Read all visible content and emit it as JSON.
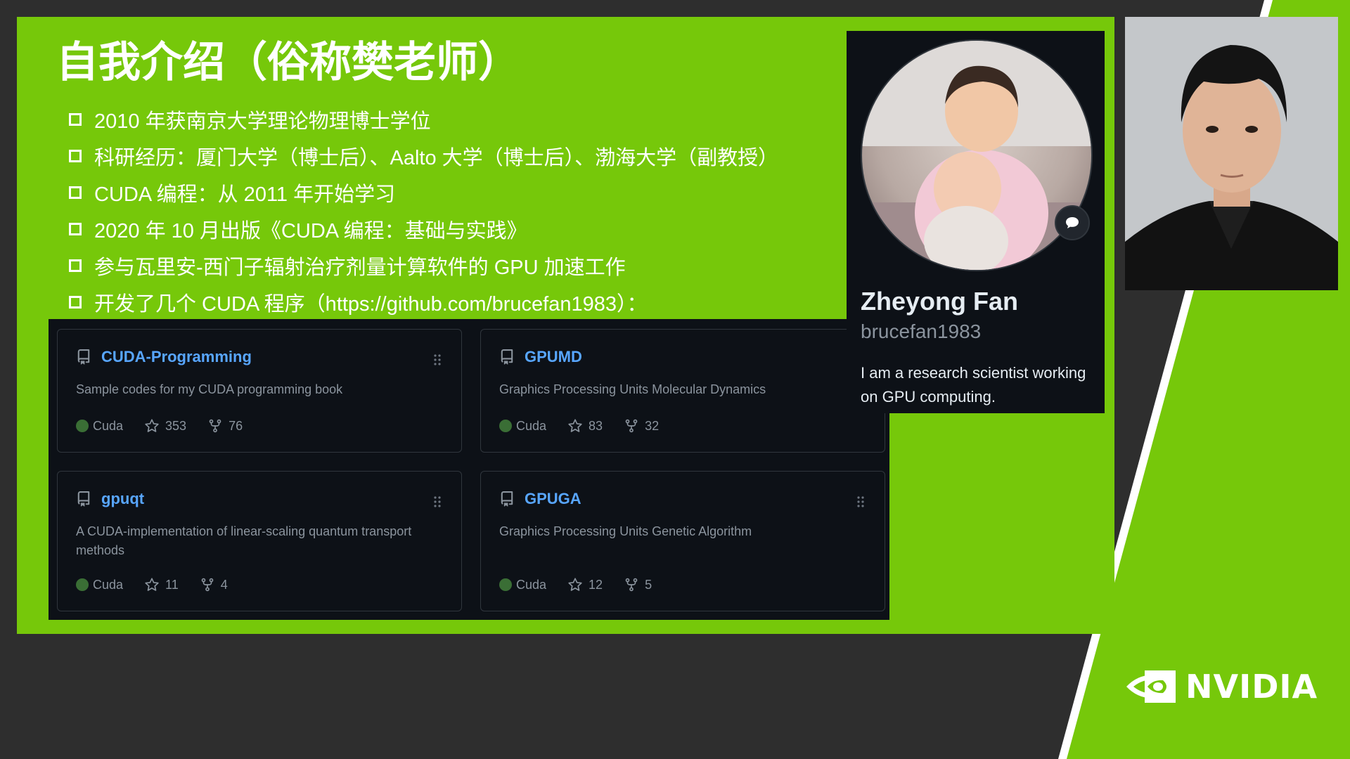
{
  "slide": {
    "title": "自我介绍（俗称樊老师）",
    "bullets": [
      "2010 年获南京大学理论物理博士学位",
      "科研经历：厦门大学（博士后）、Aalto 大学（博士后）、渤海大学（副教授）",
      "CUDA 编程：从 2011 年开始学习",
      "2020 年 10 月出版《CUDA 编程：基础与实践》",
      "参与瓦里安-西门子辐射治疗剂量计算软件的 GPU 加速工作",
      "开发了几个 CUDA 程序（https://github.com/brucefan1983）："
    ]
  },
  "repos": [
    {
      "name": "CUDA-Programming",
      "description": "Sample codes for my CUDA programming book",
      "language": "Cuda",
      "stars": "353",
      "forks": "76"
    },
    {
      "name": "GPUMD",
      "description": "Graphics Processing Units Molecular Dynamics",
      "language": "Cuda",
      "stars": "83",
      "forks": "32"
    },
    {
      "name": "gpuqt",
      "description": "A CUDA-implementation of linear-scaling quantum transport methods",
      "language": "Cuda",
      "stars": "11",
      "forks": "4"
    },
    {
      "name": "GPUGA",
      "description": "Graphics Processing Units Genetic Algorithm",
      "language": "Cuda",
      "stars": "12",
      "forks": "5"
    }
  ],
  "profile": {
    "name": "Zheyong Fan",
    "username": "brucefan1983",
    "bio": "I am a research scientist working on GPU computing."
  },
  "branding": {
    "logo_text": "NVIDIA",
    "accent_color": "#76c80a",
    "link_color": "#58a6ff",
    "card_bg": "#0d1117"
  },
  "icons": {
    "repo": "repo-icon",
    "star": "star-icon",
    "fork": "fork-icon",
    "drag": "drag-handle-icon",
    "status": "speech-bubble-icon"
  }
}
